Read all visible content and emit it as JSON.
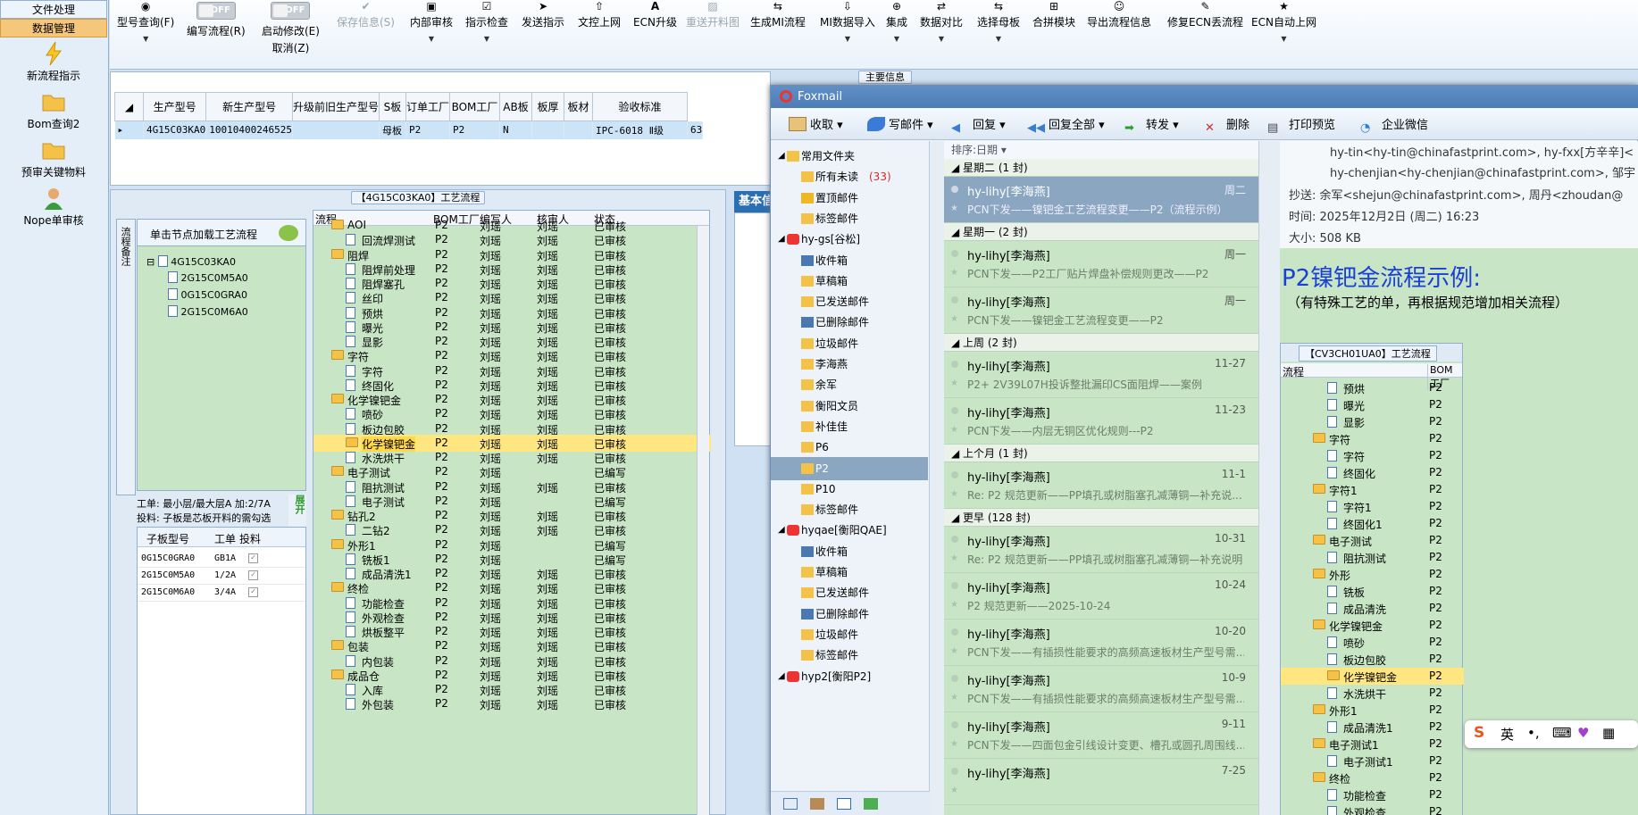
{
  "left_nav": {
    "file_menu": "文件处理",
    "data_menu": "数据管理",
    "items": [
      "新流程指示",
      "Bom查询2",
      "预审关键物料",
      "Nope单审核"
    ]
  },
  "toolbar": {
    "buttons": [
      {
        "label": "型号查询(F)",
        "icon": "binoculars-icon"
      },
      {
        "label": "编写流程(R)",
        "toggle": "OFF"
      },
      {
        "label": "启动修改(E)",
        "sub": "取消(Z)",
        "toggle": "OFF"
      },
      {
        "label": "保存信息(S)",
        "icon": "check-icon",
        "disabled": true
      },
      {
        "label": "内部审核",
        "icon": "print-icon"
      },
      {
        "label": "指示检查",
        "icon": "check-doc-icon"
      },
      {
        "label": "发送指示",
        "icon": "send-icon"
      },
      {
        "label": "文控上网",
        "icon": "upload-icon"
      },
      {
        "label": "ECN升级",
        "icon": "letter-a-icon"
      },
      {
        "label": "重送开料图",
        "icon": "image-icon",
        "disabled": true
      },
      {
        "label": "生成MI流程",
        "icon": "flow-icon"
      },
      {
        "label": "MI数据导入",
        "icon": "import-icon"
      },
      {
        "label": "集成",
        "icon": "integrate-icon"
      },
      {
        "label": "数据对比",
        "icon": "compare-icon"
      },
      {
        "label": "选择母板",
        "icon": "select-icon"
      },
      {
        "label": "合拼模块",
        "icon": "merge-icon"
      },
      {
        "label": "导出流程信息",
        "icon": "export-icon"
      },
      {
        "label": "修复ECN丢流程",
        "icon": "repair-icon"
      },
      {
        "label": "ECN自动上网",
        "icon": "star-icon"
      }
    ]
  },
  "main_info": {
    "section_title": "主要信息",
    "columns": [
      "生产型号",
      "新生产型号",
      "升级前旧生产型号",
      "S板",
      "订单工厂",
      "BOM工厂",
      "AB板",
      "板厚",
      "板材",
      "验收标准"
    ],
    "row": [
      "4G15C03KA0",
      "10010400246525",
      "",
      "母板",
      "P2",
      "P2",
      "N",
      "",
      "",
      "IPC-6018 Ⅱ级",
      "63"
    ]
  },
  "process": {
    "section_title": "【4G15C03KA0】工艺流程",
    "tree_header": "单击节点加载工艺流程",
    "vtab_label": "流程备注",
    "tree_root": "4G15C03KA0",
    "tree_children": [
      "2G15C0M5A0",
      "0G15C0GRA0",
      "2G15C0M6A0"
    ],
    "info_line1": "工单: 最小层/最大层A 加:2/7A",
    "info_line2": "投料: 子板是芯板开料的需勾选",
    "expand_label": "展开",
    "sub_columns": [
      "子板型号",
      "工单",
      "投料"
    ],
    "sub_rows": [
      {
        "model": "0G15C0GRA0",
        "order": "GB1A",
        "checked": true
      },
      {
        "model": "2G15C0M5A0",
        "order": "1/2A",
        "checked": true
      },
      {
        "model": "2G15C0M6A0",
        "order": "3/4A",
        "checked": true
      }
    ],
    "columns": [
      "流程",
      "BOM工厂",
      "编写人",
      "核审人",
      "状态"
    ],
    "rows": [
      {
        "name": "AOI",
        "level": 1,
        "type": "folder",
        "bom": "P2",
        "writer": "刘瑶",
        "reviewer": "刘瑶",
        "status": "已审核"
      },
      {
        "name": "回流焊测试",
        "level": 2,
        "type": "doc",
        "bom": "P2",
        "writer": "刘瑶",
        "reviewer": "刘瑶",
        "status": "已审核"
      },
      {
        "name": "阻焊",
        "level": 1,
        "type": "folder",
        "bom": "P2",
        "writer": "刘瑶",
        "reviewer": "刘瑶",
        "status": "已审核"
      },
      {
        "name": "阻焊前处理",
        "level": 2,
        "type": "doc",
        "bom": "P2",
        "writer": "刘瑶",
        "reviewer": "刘瑶",
        "status": "已审核"
      },
      {
        "name": "阻焊塞孔",
        "level": 2,
        "type": "doc",
        "bom": "P2",
        "writer": "刘瑶",
        "reviewer": "刘瑶",
        "status": "已审核"
      },
      {
        "name": "丝印",
        "level": 2,
        "type": "doc",
        "bom": "P2",
        "writer": "刘瑶",
        "reviewer": "刘瑶",
        "status": "已审核"
      },
      {
        "name": "预烘",
        "level": 2,
        "type": "doc",
        "bom": "P2",
        "writer": "刘瑶",
        "reviewer": "刘瑶",
        "status": "已审核"
      },
      {
        "name": "曝光",
        "level": 2,
        "type": "doc",
        "bom": "P2",
        "writer": "刘瑶",
        "reviewer": "刘瑶",
        "status": "已审核"
      },
      {
        "name": "显影",
        "level": 2,
        "type": "doc",
        "bom": "P2",
        "writer": "刘瑶",
        "reviewer": "刘瑶",
        "status": "已审核"
      },
      {
        "name": "字符",
        "level": 1,
        "type": "folder",
        "bom": "P2",
        "writer": "刘瑶",
        "reviewer": "刘瑶",
        "status": "已审核"
      },
      {
        "name": "字符",
        "level": 2,
        "type": "doc",
        "bom": "P2",
        "writer": "刘瑶",
        "reviewer": "刘瑶",
        "status": "已审核"
      },
      {
        "name": "终固化",
        "level": 2,
        "type": "doc",
        "bom": "P2",
        "writer": "刘瑶",
        "reviewer": "刘瑶",
        "status": "已审核"
      },
      {
        "name": "化学镍钯金",
        "level": 1,
        "type": "folder",
        "bom": "P2",
        "writer": "刘瑶",
        "reviewer": "刘瑶",
        "status": "已审核"
      },
      {
        "name": "喷砂",
        "level": 2,
        "type": "doc",
        "bom": "P2",
        "writer": "刘瑶",
        "reviewer": "刘瑶",
        "status": "已审核"
      },
      {
        "name": "板边包胶",
        "level": 2,
        "type": "doc",
        "bom": "P2",
        "writer": "刘瑶",
        "reviewer": "刘瑶",
        "status": "已审核"
      },
      {
        "name": "化学镍钯金",
        "level": 2,
        "type": "folder",
        "bom": "P2",
        "writer": "刘瑶",
        "reviewer": "刘瑶",
        "status": "已审核",
        "selected": true
      },
      {
        "name": "水洗烘干",
        "level": 2,
        "type": "doc",
        "bom": "P2",
        "writer": "刘瑶",
        "reviewer": "刘瑶",
        "status": "已审核"
      },
      {
        "name": "电子测试",
        "level": 1,
        "type": "folder",
        "bom": "P2",
        "writer": "刘瑶",
        "reviewer": "",
        "status": "已编写"
      },
      {
        "name": "阻抗测试",
        "level": 2,
        "type": "doc",
        "bom": "P2",
        "writer": "刘瑶",
        "reviewer": "刘瑶",
        "status": "已审核"
      },
      {
        "name": "电子测试",
        "level": 2,
        "type": "doc",
        "bom": "P2",
        "writer": "刘瑶",
        "reviewer": "",
        "status": "已编写"
      },
      {
        "name": "钻孔2",
        "level": 1,
        "type": "folder",
        "bom": "P2",
        "writer": "刘瑶",
        "reviewer": "刘瑶",
        "status": "已审核"
      },
      {
        "name": "二钻2",
        "level": 2,
        "type": "doc",
        "bom": "P2",
        "writer": "刘瑶",
        "reviewer": "刘瑶",
        "status": "已审核"
      },
      {
        "name": "外形1",
        "level": 1,
        "type": "folder",
        "bom": "P2",
        "writer": "刘瑶",
        "reviewer": "",
        "status": "已编写"
      },
      {
        "name": "铣板1",
        "level": 2,
        "type": "doc",
        "bom": "P2",
        "writer": "刘瑶",
        "reviewer": "",
        "status": "已编写"
      },
      {
        "name": "成品清洗1",
        "level": 2,
        "type": "doc",
        "bom": "P2",
        "writer": "刘瑶",
        "reviewer": "刘瑶",
        "status": "已审核"
      },
      {
        "name": "终检",
        "level": 1,
        "type": "folder",
        "bom": "P2",
        "writer": "刘瑶",
        "reviewer": "刘瑶",
        "status": "已审核"
      },
      {
        "name": "功能检查",
        "level": 2,
        "type": "doc",
        "bom": "P2",
        "writer": "刘瑶",
        "reviewer": "刘瑶",
        "status": "已审核"
      },
      {
        "name": "外观检查",
        "level": 2,
        "type": "doc",
        "bom": "P2",
        "writer": "刘瑶",
        "reviewer": "刘瑶",
        "status": "已审核"
      },
      {
        "name": "烘板整平",
        "level": 2,
        "type": "doc",
        "bom": "P2",
        "writer": "刘瑶",
        "reviewer": "刘瑶",
        "status": "已审核"
      },
      {
        "name": "包装",
        "level": 1,
        "type": "folder",
        "bom": "P2",
        "writer": "刘瑶",
        "reviewer": "刘瑶",
        "status": "已审核"
      },
      {
        "name": "内包装",
        "level": 2,
        "type": "doc",
        "bom": "P2",
        "writer": "刘瑶",
        "reviewer": "刘瑶",
        "status": "已审核"
      },
      {
        "name": "成品仓",
        "level": 1,
        "type": "folder",
        "bom": "P2",
        "writer": "刘瑶",
        "reviewer": "刘瑶",
        "status": "已审核"
      },
      {
        "name": "入库",
        "level": 2,
        "type": "doc",
        "bom": "P2",
        "writer": "刘瑶",
        "reviewer": "刘瑶",
        "status": "已审核"
      },
      {
        "name": "外包装",
        "level": 2,
        "type": "doc",
        "bom": "P2",
        "writer": "刘瑶",
        "reviewer": "刘瑶",
        "status": "已审核"
      }
    ]
  },
  "right_panel_title": "基本信",
  "foxmail": {
    "title": "Foxmail",
    "toolbar": [
      "收取",
      "写邮件",
      "回复",
      "回复全部",
      "转发",
      "删除",
      "打印预览",
      "企业微信"
    ],
    "sidebar": [
      {
        "label": "常用文件夹",
        "level": 0,
        "icon": "folder-icon"
      },
      {
        "label": "所有未读",
        "level": 1,
        "count": "(33)",
        "icon": "folder-icon"
      },
      {
        "label": "置顶邮件",
        "level": 1,
        "icon": "star-icon"
      },
      {
        "label": "标签邮件",
        "level": 1,
        "icon": "tag-icon"
      },
      {
        "label": "hy-gs[谷松]",
        "level": 0,
        "icon": "account-icon"
      },
      {
        "label": "收件箱",
        "level": 1,
        "icon": "inbox-icon"
      },
      {
        "label": "草稿箱",
        "level": 1,
        "icon": "draft-icon"
      },
      {
        "label": "已发送邮件",
        "level": 1,
        "icon": "sent-icon"
      },
      {
        "label": "已删除邮件",
        "level": 1,
        "icon": "trash-icon"
      },
      {
        "label": "垃圾邮件",
        "level": 1,
        "icon": "junk-icon"
      },
      {
        "label": "李海燕",
        "level": 1,
        "icon": "folder-icon"
      },
      {
        "label": "余军",
        "level": 1,
        "icon": "folder-icon"
      },
      {
        "label": "衡阳文员",
        "level": 1,
        "icon": "folder-icon"
      },
      {
        "label": "补佳佳",
        "level": 1,
        "icon": "folder-icon"
      },
      {
        "label": "P6",
        "level": 1,
        "icon": "folder-icon"
      },
      {
        "label": "P2",
        "level": 1,
        "icon": "folder-icon",
        "selected": true
      },
      {
        "label": "P10",
        "level": 1,
        "icon": "folder-icon"
      },
      {
        "label": "标签邮件",
        "level": 1,
        "icon": "tag-icon"
      },
      {
        "label": "hyqae[衡阳QAE]",
        "level": 0,
        "icon": "account-icon"
      },
      {
        "label": "收件箱",
        "level": 1,
        "icon": "inbox-icon"
      },
      {
        "label": "草稿箱",
        "level": 1,
        "icon": "draft-icon"
      },
      {
        "label": "已发送邮件",
        "level": 1,
        "icon": "sent-icon"
      },
      {
        "label": "已删除邮件",
        "level": 1,
        "icon": "trash-icon"
      },
      {
        "label": "垃圾邮件",
        "level": 1,
        "icon": "junk-icon"
      },
      {
        "label": "标签邮件",
        "level": 1,
        "icon": "tag-icon"
      },
      {
        "label": "hyp2[衡阳P2]",
        "level": 0,
        "icon": "account-icon"
      }
    ],
    "sort_label": "排序:日期",
    "list": [
      {
        "group": "星期二 (1 封)"
      },
      {
        "sender": "hy-lihy[李海燕]",
        "subject": "PCN下发——镍钯金工艺流程变更——P2（流程示例）",
        "date": "周二",
        "selected": true
      },
      {
        "group": "星期一 (2 封)"
      },
      {
        "sender": "hy-lihy[李海燕]",
        "subject": "PCN下发——P2工厂贴片焊盘补偿规则更改——P2",
        "date": "周一"
      },
      {
        "sender": "hy-lihy[李海燕]",
        "subject": "PCN下发——镍钯金工艺流程变更——P2",
        "date": "周一"
      },
      {
        "group": "上周 (2 封)"
      },
      {
        "sender": "hy-lihy[李海燕]",
        "subject": "P2+ 2V39L07H投诉整批漏印CS面阻焊——案例",
        "date": "11-27"
      },
      {
        "sender": "hy-lihy[李海燕]",
        "subject": "PCN下发——内层无铜区优化规则---P2",
        "date": "11-23"
      },
      {
        "group": "上个月 (1 封)"
      },
      {
        "sender": "hy-lihy[李海燕]",
        "subject": "Re: P2 规范更新——PP填孔或树脂塞孔减薄铜—补充说...",
        "date": "11-1"
      },
      {
        "group": "更早 (128 封)"
      },
      {
        "sender": "hy-lihy[李海燕]",
        "subject": "Re: P2 规范更新——PP填孔或树脂塞孔减薄铜—补充说明",
        "date": "10-31"
      },
      {
        "sender": "hy-lihy[李海燕]",
        "subject": "P2 规范更新——2025-10-24",
        "date": "10-24"
      },
      {
        "sender": "hy-lihy[李海燕]",
        "subject": "PCN下发——有插损性能要求的高频高速板材生产型号需...",
        "date": "10-20"
      },
      {
        "sender": "hy-lihy[李海燕]",
        "subject": "PCN下发——有插损性能要求的高频高速板材生产型号需...",
        "date": "10-9"
      },
      {
        "sender": "hy-lihy[李海燕]",
        "subject": "PCN下发——四面包金引线设计变更、槽孔或圆孔周围线...",
        "date": "9-11"
      },
      {
        "sender": "hy-lihy[李海燕]",
        "subject": "",
        "date": "7-25"
      }
    ],
    "reading": {
      "to_line1": "hy-tin<hy-tin@chinafastprint.com>, hy-fxx[方辛辛]<",
      "to_line2": "hy-chenjian<hy-chenjian@chinafastprint.com>, 邹宇",
      "cc": "抄送: 余军<shejun@chinafastprint.com>, 周丹<zhoudan@",
      "time": "时间: 2025年12月2日 (周二) 16:23",
      "size": "大小: 508 KB",
      "heading": "P2镍钯金流程示例:",
      "subheading": "（有特殊工艺的单，再根据规范增加相关流程）",
      "embed_title": "【CV3CH01UA0】工艺流程",
      "embed_cols": [
        "流程",
        "BOM工厂"
      ],
      "embed_rows": [
        {
          "name": "预烘",
          "level": 2,
          "type": "doc",
          "bom": "P2"
        },
        {
          "name": "曝光",
          "level": 2,
          "type": "doc",
          "bom": "P2"
        },
        {
          "name": "显影",
          "level": 2,
          "type": "doc",
          "bom": "P2"
        },
        {
          "name": "字符",
          "level": 1,
          "type": "folder",
          "bom": "P2"
        },
        {
          "name": "字符",
          "level": 2,
          "type": "doc",
          "bom": "P2"
        },
        {
          "name": "终固化",
          "level": 2,
          "type": "doc",
          "bom": "P2"
        },
        {
          "name": "字符1",
          "level": 1,
          "type": "folder",
          "bom": "P2"
        },
        {
          "name": "字符1",
          "level": 2,
          "type": "doc",
          "bom": "P2"
        },
        {
          "name": "终固化1",
          "level": 2,
          "type": "doc",
          "bom": "P2"
        },
        {
          "name": "电子测试",
          "level": 1,
          "type": "folder",
          "bom": "P2"
        },
        {
          "name": "阻抗测试",
          "level": 2,
          "type": "doc",
          "bom": "P2"
        },
        {
          "name": "外形",
          "level": 1,
          "type": "folder",
          "bom": "P2"
        },
        {
          "name": "铣板",
          "level": 2,
          "type": "doc",
          "bom": "P2"
        },
        {
          "name": "成品清洗",
          "level": 2,
          "type": "doc",
          "bom": "P2"
        },
        {
          "name": "化学镍钯金",
          "level": 1,
          "type": "folder",
          "bom": "P2"
        },
        {
          "name": "喷砂",
          "level": 2,
          "type": "doc",
          "bom": "P2"
        },
        {
          "name": "板边包胶",
          "level": 2,
          "type": "doc",
          "bom": "P2"
        },
        {
          "name": "化学镍钯金",
          "level": 2,
          "type": "folder",
          "bom": "P2",
          "selected": true
        },
        {
          "name": "水洗烘干",
          "level": 2,
          "type": "doc",
          "bom": "P2"
        },
        {
          "name": "外形1",
          "level": 1,
          "type": "folder",
          "bom": "P2"
        },
        {
          "name": "成品清洗1",
          "level": 2,
          "type": "doc",
          "bom": "P2"
        },
        {
          "name": "电子测试1",
          "level": 1,
          "type": "folder",
          "bom": "P2"
        },
        {
          "name": "电子测试1",
          "level": 2,
          "type": "doc",
          "bom": "P2"
        },
        {
          "name": "终检",
          "level": 1,
          "type": "folder",
          "bom": "P2"
        },
        {
          "name": "功能检查",
          "level": 2,
          "type": "doc",
          "bom": "P2"
        },
        {
          "name": "外观检查",
          "level": 2,
          "type": "doc",
          "bom": "P2"
        }
      ]
    }
  },
  "ime": {
    "logo": "S",
    "lang": "英"
  },
  "colors": {
    "tree_green": "#c8e6c6",
    "selection_yellow": "#ffe680",
    "selected_mail": "#8aa6c1",
    "heading_blue": "#1a3fd6"
  }
}
